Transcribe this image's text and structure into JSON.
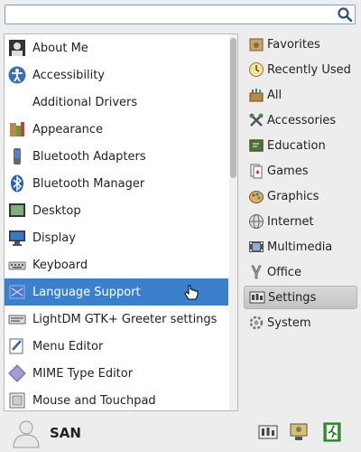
{
  "search": {
    "value": "",
    "placeholder": ""
  },
  "apps": [
    {
      "label": "About Me",
      "icon": "about-me-icon"
    },
    {
      "label": "Accessibility",
      "icon": "accessibility-icon"
    },
    {
      "label": "Additional Drivers",
      "icon": ""
    },
    {
      "label": "Appearance",
      "icon": "appearance-icon"
    },
    {
      "label": "Bluetooth Adapters",
      "icon": "bluetooth-adapters-icon"
    },
    {
      "label": "Bluetooth Manager",
      "icon": "bluetooth-icon"
    },
    {
      "label": "Desktop",
      "icon": "desktop-icon"
    },
    {
      "label": "Display",
      "icon": "display-icon"
    },
    {
      "label": "Keyboard",
      "icon": "keyboard-icon"
    },
    {
      "label": "Language Support",
      "icon": "flag-icon",
      "selected": true
    },
    {
      "label": "LightDM GTK+ Greeter settings",
      "icon": "greeter-icon"
    },
    {
      "label": "Menu Editor",
      "icon": "menu-editor-icon"
    },
    {
      "label": "MIME Type Editor",
      "icon": "mime-icon"
    },
    {
      "label": "Mouse and Touchpad",
      "icon": "mouse-icon"
    }
  ],
  "categories": [
    {
      "label": "Favorites",
      "icon": "favorites-icon"
    },
    {
      "label": "Recently Used",
      "icon": "clock-icon"
    },
    {
      "label": "All",
      "icon": "all-icon"
    },
    {
      "label": "Accessories",
      "icon": "accessories-icon"
    },
    {
      "label": "Education",
      "icon": "education-icon"
    },
    {
      "label": "Games",
      "icon": "games-icon"
    },
    {
      "label": "Graphics",
      "icon": "graphics-icon"
    },
    {
      "label": "Internet",
      "icon": "internet-icon"
    },
    {
      "label": "Multimedia",
      "icon": "multimedia-icon"
    },
    {
      "label": "Office",
      "icon": "office-icon"
    },
    {
      "label": "Settings",
      "icon": "settings-icon",
      "selected": true
    },
    {
      "label": "System",
      "icon": "system-icon"
    }
  ],
  "user": {
    "name": "SAN"
  },
  "colors": {
    "selection": "#3b80cd",
    "search_border": "#7da0c9"
  }
}
